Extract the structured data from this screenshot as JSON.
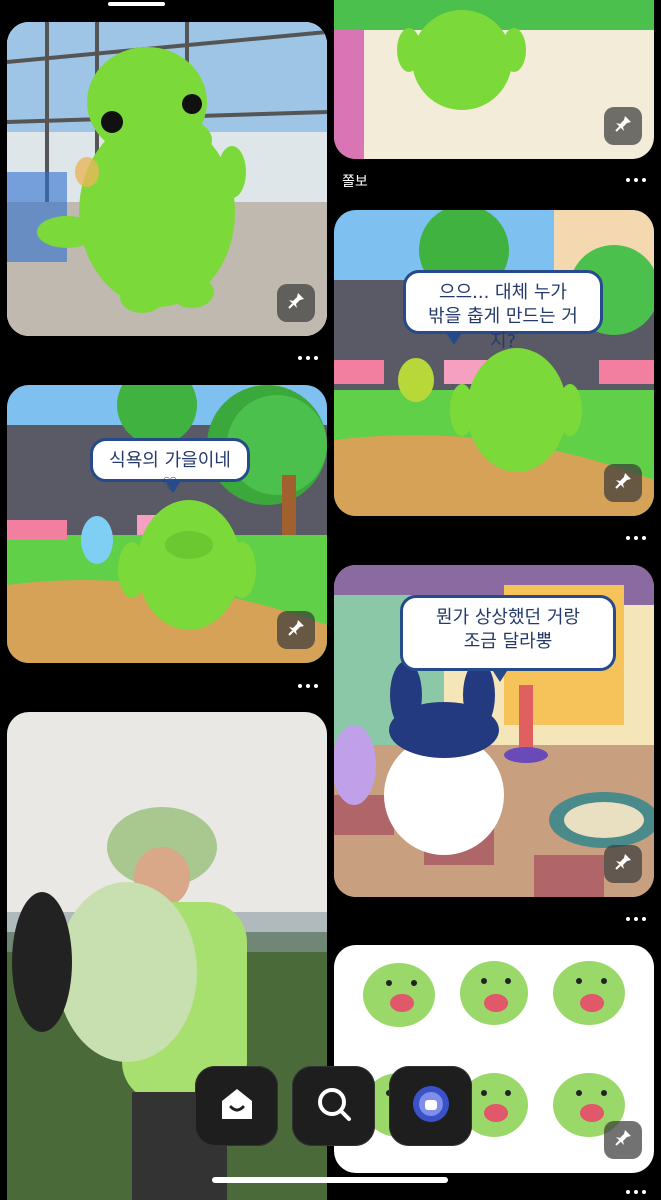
{
  "app": {
    "feed": {
      "right_column_caption": "쫄보"
    },
    "bubbles": {
      "garden_left": "식욕의 가을이네♡",
      "garden_right_line1": "으으... 대체 누가",
      "garden_right_line2": "밖을 춥게 만드는 거지?",
      "room_line1": "뭔가 상상했던 거랑",
      "room_line2": "조금 달라뿡"
    },
    "icons": {
      "pin": "pin-icon",
      "more": "more-icon",
      "home": "home-icon",
      "search": "search-icon",
      "profile": "profile-avatar"
    },
    "colors": {
      "background": "#000000",
      "character_green": "#7cd93a",
      "bubble_border": "#274a8a"
    }
  }
}
